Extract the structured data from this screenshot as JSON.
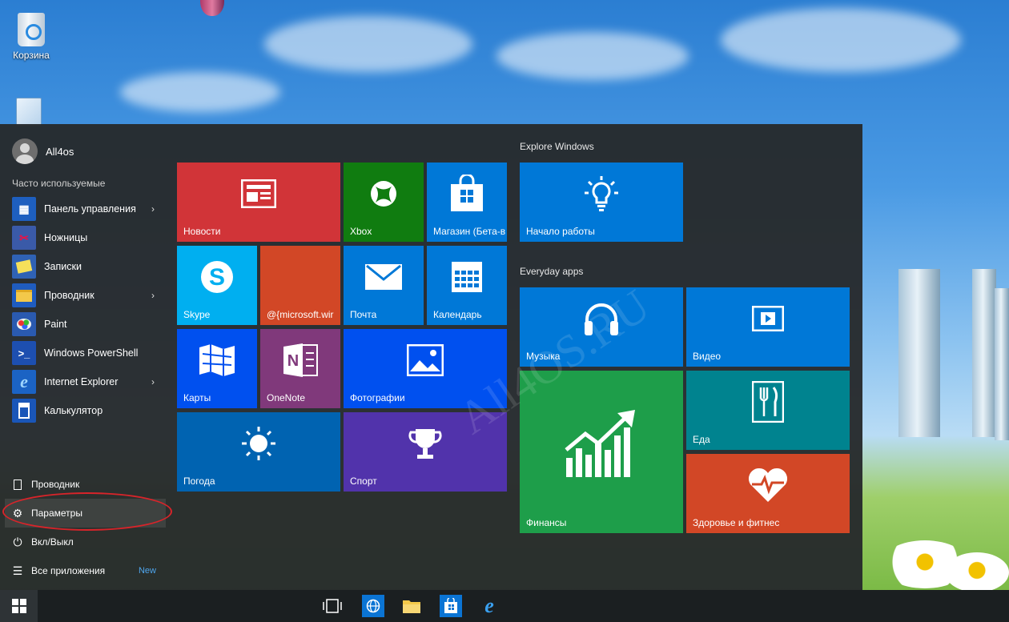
{
  "desktop": {
    "icons": [
      {
        "label": "Корзина",
        "icon": "recycle-bin-icon"
      },
      {
        "label": "",
        "icon": "control-panel-icon"
      }
    ]
  },
  "start_menu": {
    "user": {
      "name": "All4os",
      "icon": "user-avatar-icon"
    },
    "most_used_label": "Часто используемые",
    "apps": [
      {
        "label": "Панель управления",
        "icon": "control-panel-icon",
        "has_submenu": true
      },
      {
        "label": "Ножницы",
        "icon": "snipping-tool-icon",
        "has_submenu": false
      },
      {
        "label": "Записки",
        "icon": "sticky-notes-icon",
        "has_submenu": false
      },
      {
        "label": "Проводник",
        "icon": "file-explorer-icon",
        "has_submenu": true
      },
      {
        "label": "Paint",
        "icon": "paint-icon",
        "has_submenu": false
      },
      {
        "label": "Windows PowerShell",
        "icon": "powershell-icon",
        "has_submenu": false
      },
      {
        "label": "Internet Explorer",
        "icon": "internet-explorer-icon",
        "has_submenu": true
      },
      {
        "label": "Калькулятор",
        "icon": "calculator-icon",
        "has_submenu": false
      }
    ],
    "chevron": "›",
    "bottom": {
      "explorer": "Проводник",
      "settings": "Параметры",
      "power": "Вкл/Выкл",
      "all_apps": "Все приложения",
      "new_badge": "New"
    },
    "tiles": {
      "news": "Новости",
      "xbox": "Xbox",
      "store": "Магазин (Бета-в",
      "skype": "Skype",
      "mail_account": "@{microsoft.wir",
      "mail": "Почта",
      "calendar": "Календарь",
      "maps": "Карты",
      "onenote": "OneNote",
      "photos": "Фотографии",
      "weather": "Погода",
      "sport": "Спорт"
    },
    "explore_group": "Explore Windows",
    "explore_tiles": {
      "getting_started": "Начало работы"
    },
    "everyday_group": "Everyday apps",
    "everyday_tiles": {
      "music": "Музыка",
      "video": "Видео",
      "finance": "Финансы",
      "food": "Еда",
      "health": "Здоровье и фитнес"
    }
  },
  "watermark": "All4OS.RU",
  "taskbar": {
    "icons": [
      "windows-start-icon",
      "task-view-icon",
      "globe-icon",
      "folder-icon",
      "store-icon",
      "internet-explorer-icon"
    ]
  },
  "colors": {
    "news": "#d13438",
    "xbox": "#107c10",
    "blue": "#0078d7",
    "skype": "#00aff0",
    "orange_red": "#d24726",
    "navy": "#0050ef",
    "onenote": "#80397b",
    "violet": "#5133ab",
    "green": "#1e9e4a",
    "teal": "#00838f",
    "health": "#d24726",
    "taskbar": "#1b1f21",
    "accent_new": "#4ea6ee",
    "highlight_ellipse": "#d8242a"
  }
}
